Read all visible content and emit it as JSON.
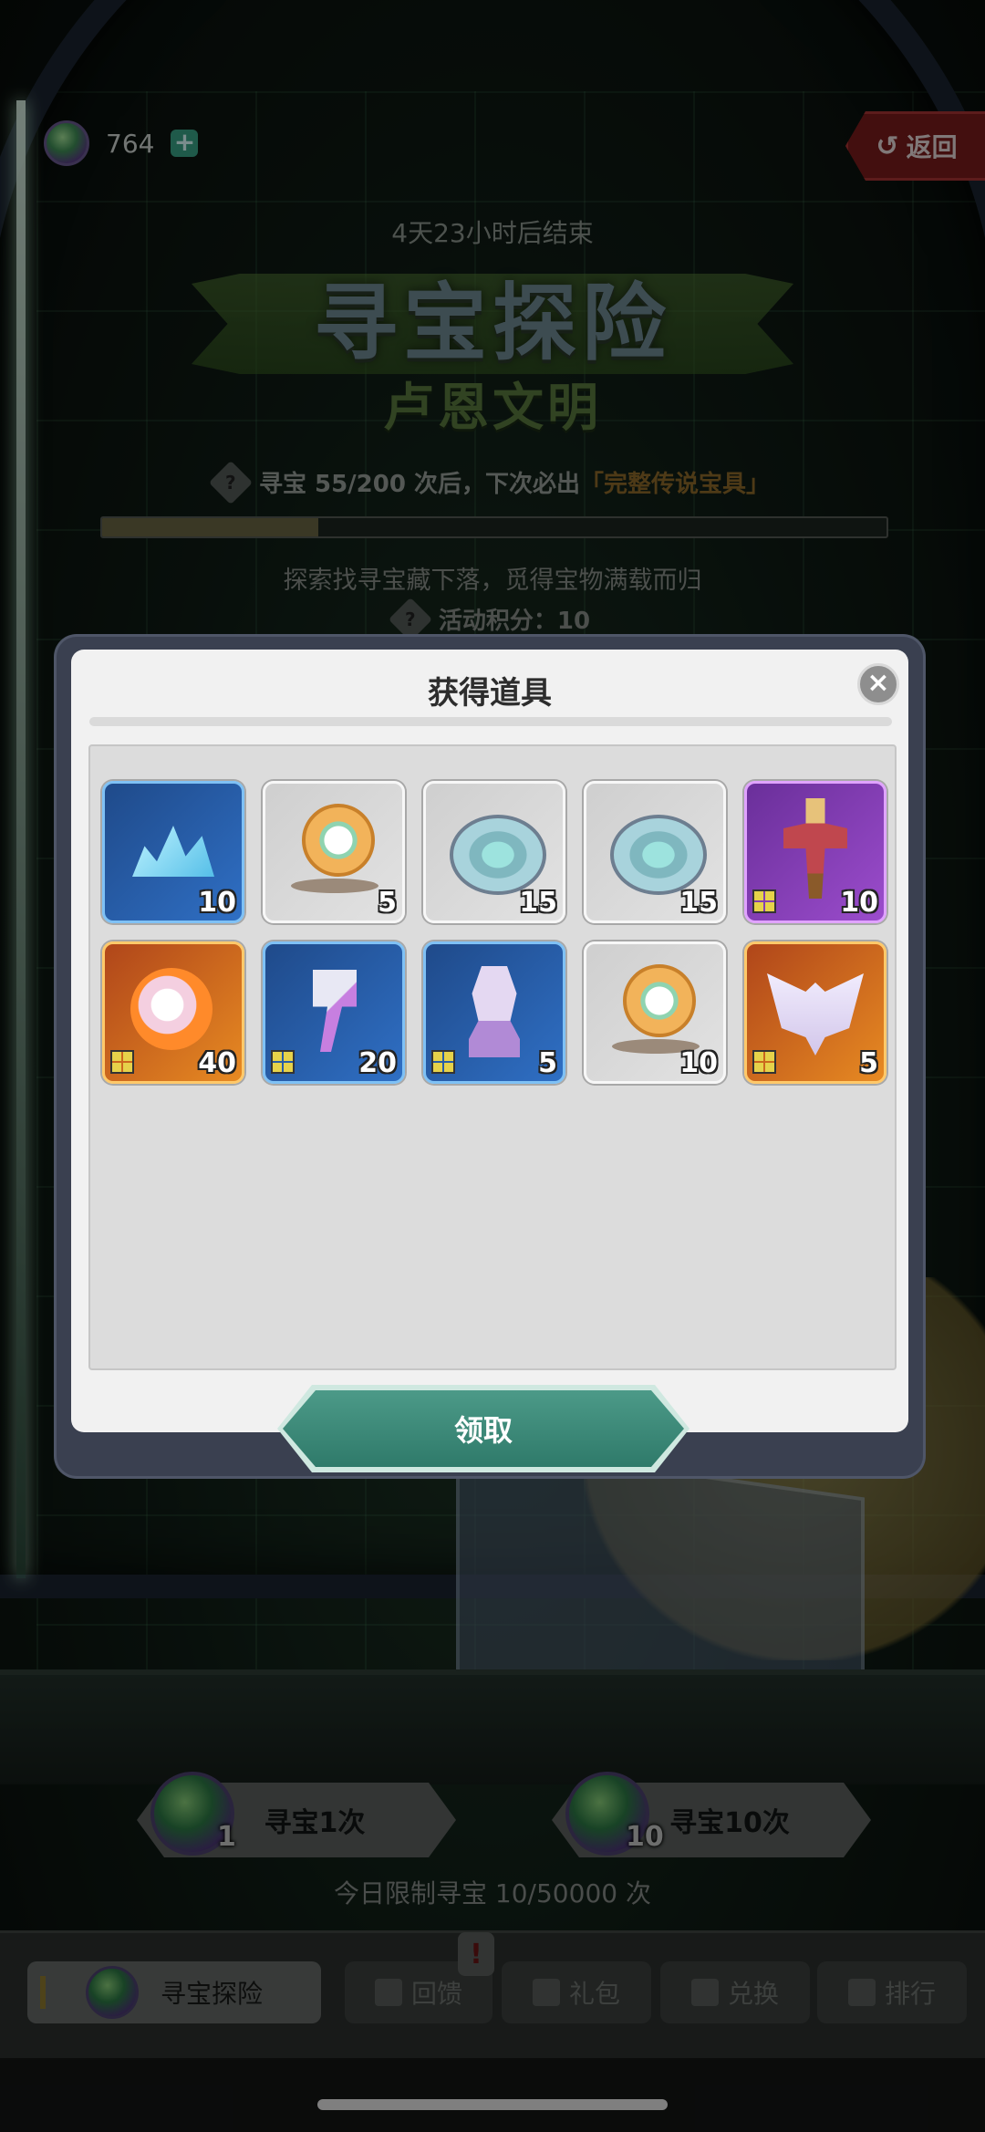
{
  "top_bar": {
    "currency_icon": "gem-orb-icon",
    "currency_amount": "764",
    "plus_label": "+",
    "back_label": "返回"
  },
  "event": {
    "end_time": "4天23小时后结束",
    "title": "寻宝探险",
    "subtitle": "卢恩文明",
    "guarantee_prefix": "寻宝 55/200 次后，下次必出",
    "guarantee_highlight": "「完整传说宝具」",
    "progress_fraction": 0.275,
    "description": "探索找寻宝藏下落，觅得宝物满载而归",
    "points_label": "活动积分：10"
  },
  "modal": {
    "title": "获得道具",
    "close_label": "×",
    "claim_label": "领取",
    "items": [
      {
        "icon": "blue-crystal-icon",
        "rarity": "blue",
        "qty": "10",
        "fragment": false
      },
      {
        "icon": "gold-medal-icon",
        "rarity": "gray",
        "qty": "5",
        "fragment": false
      },
      {
        "icon": "silver-coin-icon",
        "rarity": "gray",
        "qty": "15",
        "fragment": false
      },
      {
        "icon": "silver-coin-icon",
        "rarity": "gray",
        "qty": "15",
        "fragment": false
      },
      {
        "icon": "scarecrow-icon",
        "rarity": "purple",
        "qty": "10",
        "fragment": true
      },
      {
        "icon": "fire-orb-icon",
        "rarity": "orange",
        "qty": "40",
        "fragment": true
      },
      {
        "icon": "crystal-hammer-icon",
        "rarity": "blue",
        "qty": "20",
        "fragment": true
      },
      {
        "icon": "statue-bust-icon",
        "rarity": "blue",
        "qty": "5",
        "fragment": true
      },
      {
        "icon": "gold-medal-icon",
        "rarity": "gray",
        "qty": "10",
        "fragment": false
      },
      {
        "icon": "angel-wings-icon",
        "rarity": "orange",
        "qty": "5",
        "fragment": true
      }
    ]
  },
  "draw": {
    "single_label": "寻宝1次",
    "single_count": "1",
    "multi_label": "寻宝10次",
    "multi_count": "10",
    "daily_limit": "今日限制寻宝 10/50000 次"
  },
  "nav": {
    "tabs": [
      {
        "label": "寻宝探险",
        "icon": "gem-orb-icon",
        "active": true
      },
      {
        "label": "回馈",
        "icon": "calendar-icon",
        "active": false
      },
      {
        "label": "礼包",
        "icon": "gift-shop-icon",
        "active": false
      },
      {
        "label": "兑换",
        "icon": "swap-arrows-icon",
        "active": false
      },
      {
        "label": "排行",
        "icon": "ranking-icon",
        "active": false
      }
    ],
    "alert_label": "!"
  }
}
